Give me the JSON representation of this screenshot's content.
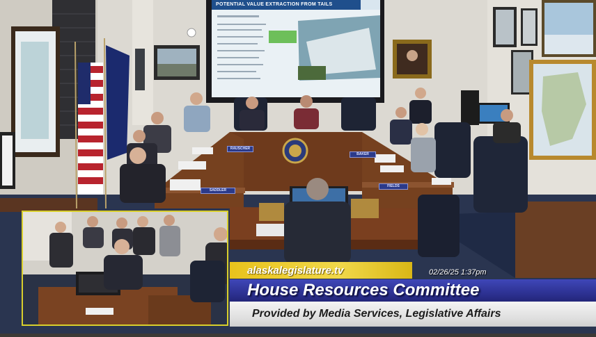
{
  "projection": {
    "slide_title": "POTENTIAL VALUE EXTRACTION FROM TAILS"
  },
  "nameplates": {
    "left_front": "SADDLER",
    "left_mid": "RAUSCHER",
    "right_front": "FIELDS",
    "right_mid": "BAKER"
  },
  "broadcast": {
    "website": "alaskalegislature.tv",
    "datetime": "02/26/25 1:37pm",
    "committee": "House Resources Committee",
    "credit": "Provided by Media Services, Legislative Affairs"
  },
  "colors": {
    "url_bar": "#e8c21c",
    "title_bar": "#2b2f8e",
    "credit_bar": "#e0e0e0",
    "inset_border": "#d9cf2c"
  }
}
